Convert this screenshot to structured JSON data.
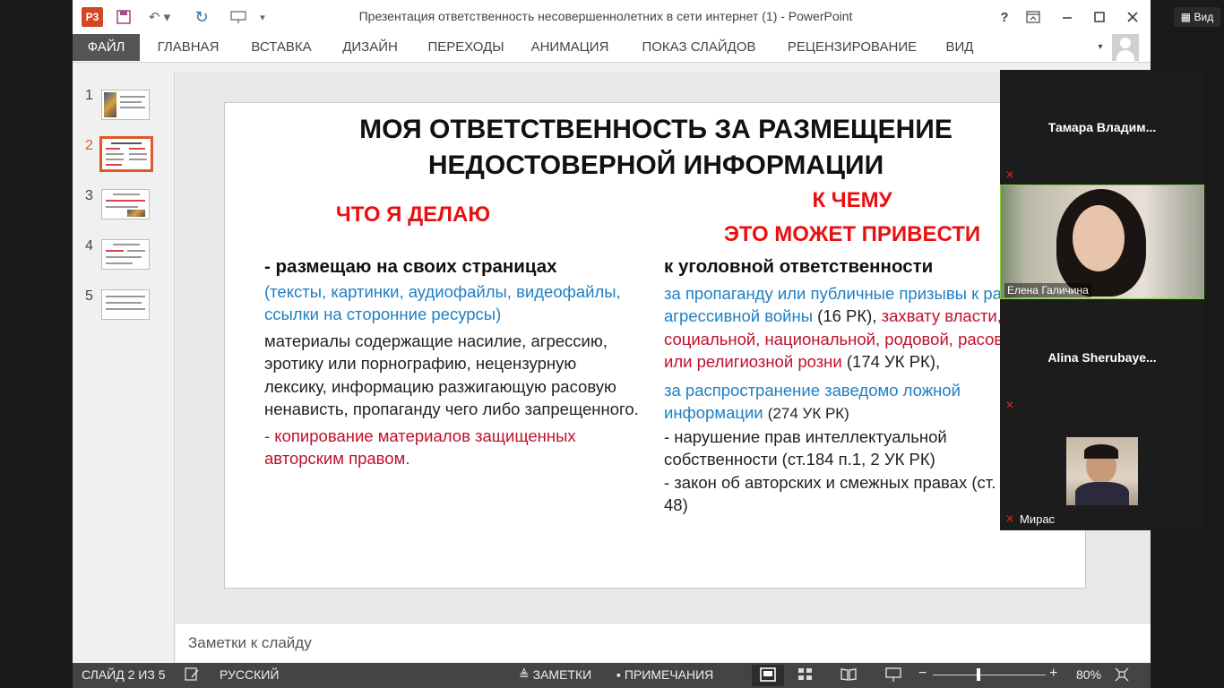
{
  "window": {
    "title": "Презентация ответственность несовершеннолетних в сети интернет (1) - PowerPoint",
    "help_label": "?"
  },
  "ribbon": {
    "tabs": [
      "ФАЙЛ",
      "ГЛАВНАЯ",
      "ВСТАВКА",
      "ДИЗАЙН",
      "ПЕРЕХОДЫ",
      "АНИМАЦИЯ",
      "ПОКАЗ СЛАЙДОВ",
      "РЕЦЕНЗИРОВАНИЕ",
      "ВИД"
    ]
  },
  "thumbnails": {
    "numbers": [
      "1",
      "2",
      "3",
      "4",
      "5"
    ],
    "active": 2
  },
  "slide": {
    "title_line1": "МОЯ ОТВЕТСТВЕННОСТЬ ЗА РАЗМЕЩЕНИЕ",
    "title_line2": "НЕДОСТОВЕРНОЙ ИНФОРМАЦИИ",
    "left": {
      "heading": "ЧТО Я ДЕЛАЮ",
      "bold": "- размещаю на своих страницах",
      "blue": "(тексты, картинки, аудиофайлы, видеофайлы, ссылки на сторонние ресурсы)",
      "plain": "материалы содержащие насилие, агрессию, эротику или порнографию, нецензурную лексику, информацию разжигающую расовую ненависть, пропаганду чего либо запрещенного.",
      "red": "- копирование материалов защищенных авторским правом."
    },
    "right": {
      "heading_line1": "К ЧЕМУ",
      "heading_line2": "ЭТО МОЖЕТ ПРИВЕСТИ",
      "bold": "к уголовной ответственности",
      "blue1": "за пропаганду или публичные призывы к развязыванию агрессивной войны",
      "p1a": "(16",
      "p1b": "РК),",
      "red1": "захвату власти, разжигание социальной, национальной, родовой, расовой, сословной или религиозной розни",
      "p1c": "(174 УК РК),",
      "blue2": "за распространение  заведомо ложной информации",
      "p2": "(274 УК РК)",
      "p3": "-  нарушение прав интеллектуальной собственности (ст.184 п.1, 2 УК РК)",
      "p4": "- закон об авторских и смежных правах (ст. 48)"
    }
  },
  "notes": {
    "placeholder": "Заметки к слайду"
  },
  "statusbar": {
    "slide_info": "СЛАЙД 2 ИЗ 5",
    "language": "РУССКИЙ",
    "notes": "ЗАМЕТКИ",
    "comments": "ПРИМЕЧАНИЯ",
    "zoom": "80%",
    "zoom_value": 0.8
  },
  "zoom_panel": {
    "view_label": "Вид",
    "participants": [
      {
        "name": "Тамара  Владим..."
      },
      {
        "name": "Елена Галичина"
      },
      {
        "name": "Alina  Sherubaye..."
      },
      {
        "name": "Мирас"
      }
    ]
  }
}
